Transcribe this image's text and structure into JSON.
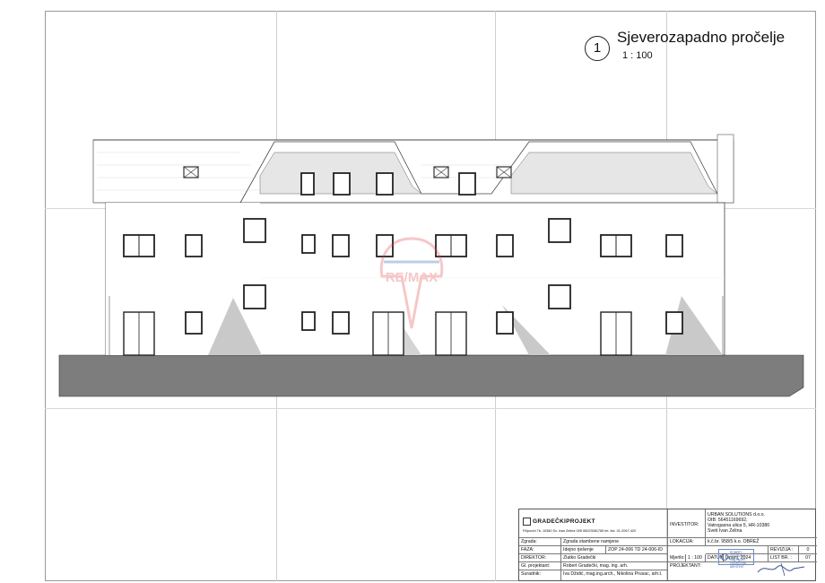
{
  "drawing": {
    "number": "1",
    "title": "Sjeverozapadno pročelje",
    "scale": "1 : 100"
  },
  "watermark": {
    "brand": "RE/MAX",
    "color": "#e03a3e",
    "accent": "#1b4f9c"
  },
  "title_block": {
    "firm_name": "GRADEČKIPROJEKT",
    "firm_address": "Filipovići 7b, 10360 Sv. Ivan Zelina OIB 55023081765 tel. fax. 01-2067-420",
    "rows": [
      {
        "label": "Zgrada:",
        "value": "Zgrada stambene namjene"
      },
      {
        "label": "FAZA:",
        "value": "Idejno rješenje",
        "code": "ZOP 24-006 TD 24-006-ID"
      },
      {
        "label": "DIREKTOR:",
        "value": "Zlatko Gradečki"
      },
      {
        "label": "Gl. projektant:",
        "value": "Robert Gradečki, mag. ing. arh."
      },
      {
        "label": "Suradnik:",
        "value": "Iva Džidić, mag.ing.arch., Nikolina Prusac, arh.t."
      }
    ],
    "investor_label": "INVESTITOR:",
    "investor_lines": [
      "URBAN SOLUTIONS d.o.o.",
      "OIB: 56451169692,",
      "Vatrogasna ulica 5, HR-10380",
      "Sveti Ivan Zelina"
    ],
    "location_label": "LOKACIJA:",
    "location_value": "k.č.br. 958/5 k.o. OBREŽ",
    "revision_label": "REVIZIJA :",
    "revision_value": "0",
    "scale_label": "Mjerilo:",
    "scale_value": "1 : 100",
    "date_label": "DATUM:",
    "date_value": "Lipanj, 2024",
    "sheet_label": "LIST BR. :",
    "sheet_value": "07",
    "designer_label": "PROJEKTANT:",
    "stamp_lines": [
      "ROBERT GRADEČKI",
      "mag.ing.arh.",
      "OVLAŠTENI ARHITEKT"
    ]
  }
}
